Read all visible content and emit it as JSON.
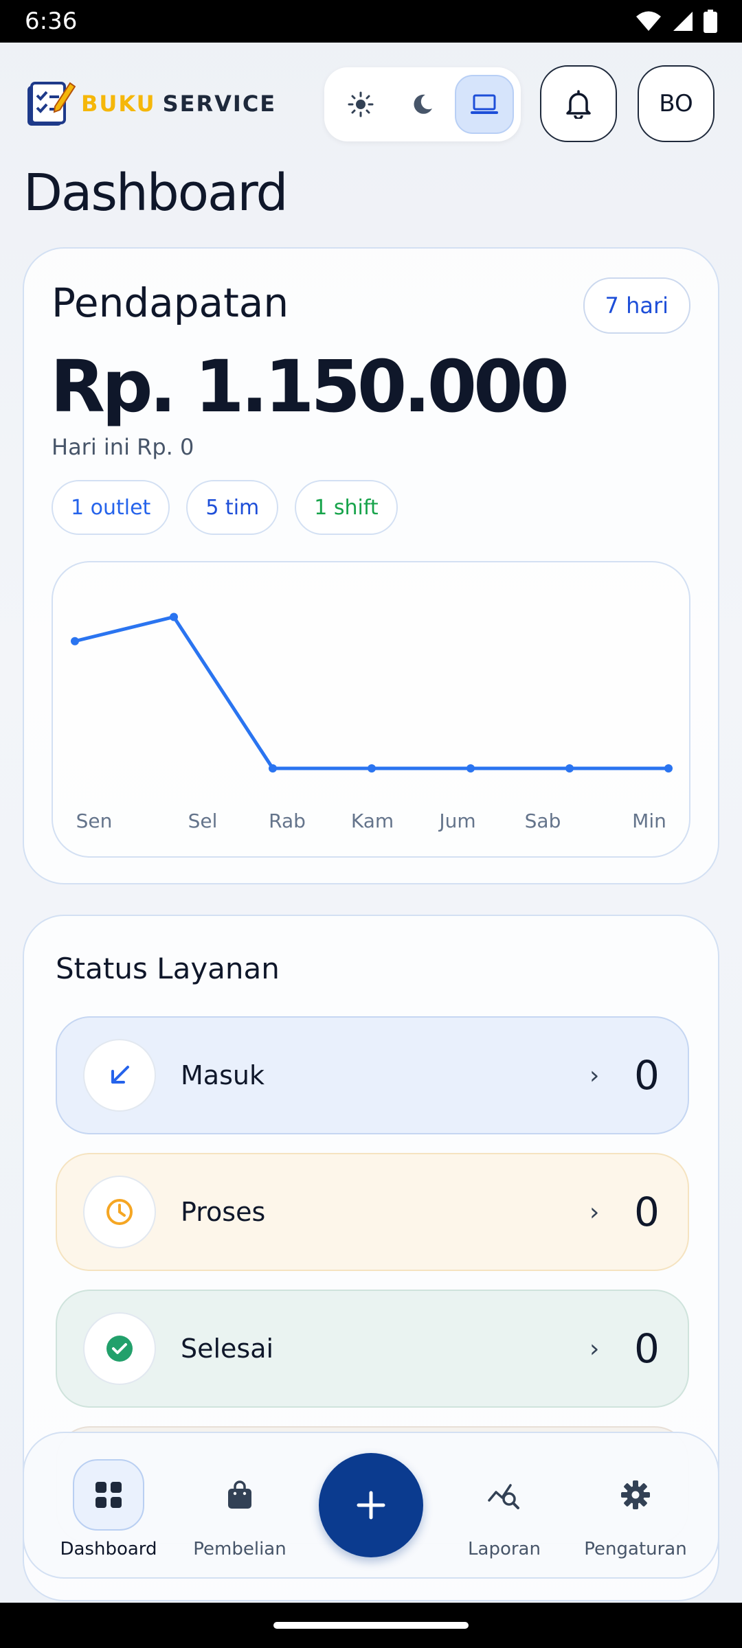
{
  "status_bar": {
    "time": "6:36"
  },
  "header": {
    "app_name_part1": "BUKU",
    "app_name_part2": "SERVICE",
    "theme_options": [
      "light-icon",
      "dark-icon",
      "system-icon"
    ],
    "theme_selected": "system",
    "avatar_initials": "BO"
  },
  "page_title": "Dashboard",
  "revenue": {
    "title": "Pendapatan",
    "range_label": "7 hari",
    "amount": "Rp. 1.150.000",
    "today": "Hari ini Rp. 0",
    "pills": [
      {
        "label": "1 outlet",
        "color": "#2563eb"
      },
      {
        "label": "5 tim",
        "color": "#1d4ed8"
      },
      {
        "label": "1 shift",
        "color": "#16a34a"
      }
    ]
  },
  "chart_data": {
    "type": "line",
    "categories": [
      "Sen",
      "Sel",
      "Rab",
      "Kam",
      "Jum",
      "Sab",
      "Min"
    ],
    "values": [
      525000,
      625000,
      0,
      0,
      0,
      0,
      0
    ],
    "ylim": [
      0,
      700000
    ],
    "grid": false,
    "legend": "none",
    "color": "#2a74f0"
  },
  "status": {
    "title": "Status Layanan",
    "rows": [
      {
        "label": "Masuk",
        "count": "0",
        "icon": "arrow-down-left-icon",
        "bg": "#e9f0fc",
        "border": "#c5d6f2",
        "icon_color": "#2563eb"
      },
      {
        "label": "Proses",
        "count": "0",
        "icon": "clock-icon",
        "bg": "#fdf6ea",
        "border": "#f5e3c0",
        "icon_color": "#f5a623"
      },
      {
        "label": "Selesai",
        "count": "0",
        "icon": "check-circle-icon",
        "bg": "#eaf3f1",
        "border": "#cfe3dc",
        "icon_color": "#22a06b"
      }
    ]
  },
  "bottom_nav": {
    "items": [
      {
        "label": "Dashboard",
        "icon": "grid-icon"
      },
      {
        "label": "Pembelian",
        "icon": "shopping-bag-icon"
      },
      {
        "label": "Laporan",
        "icon": "report-search-icon"
      },
      {
        "label": "Pengaturan",
        "icon": "gear-icon"
      }
    ],
    "fab_icon": "plus-icon"
  }
}
